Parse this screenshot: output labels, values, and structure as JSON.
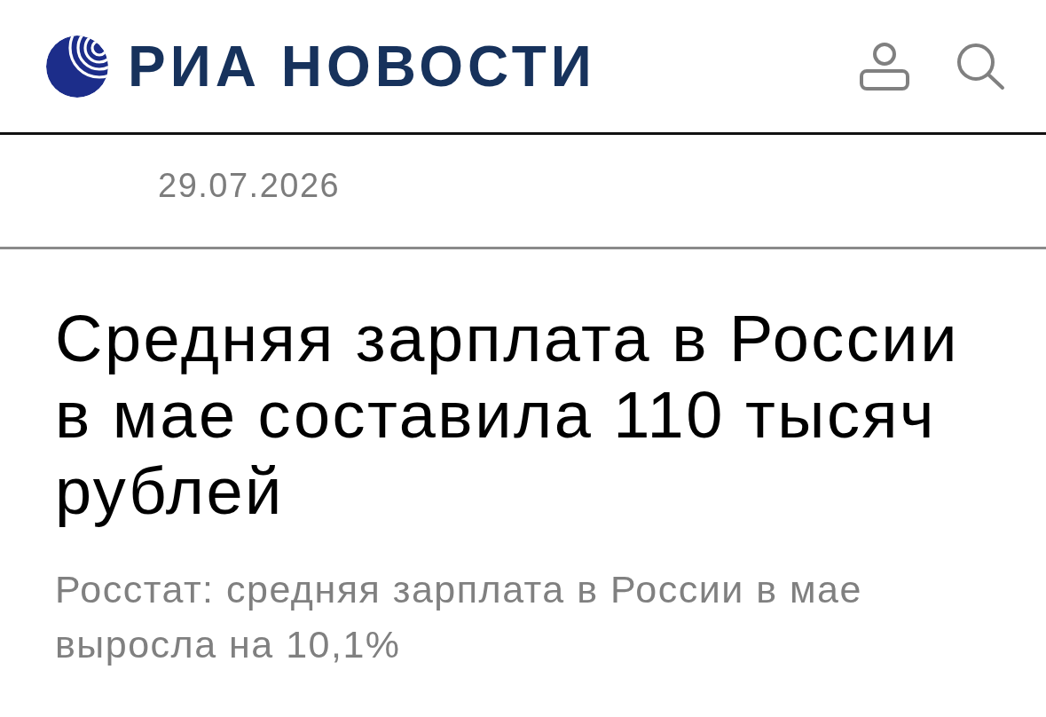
{
  "header": {
    "logo_text": "РИА НОВОСТИ"
  },
  "article": {
    "date": "29.07.2026",
    "headline": "Средняя зарплата в России в мае составила 110 тысяч рублей",
    "lead": "Росстат: средняя зарплата в России в мае выросла на 10,1%"
  }
}
